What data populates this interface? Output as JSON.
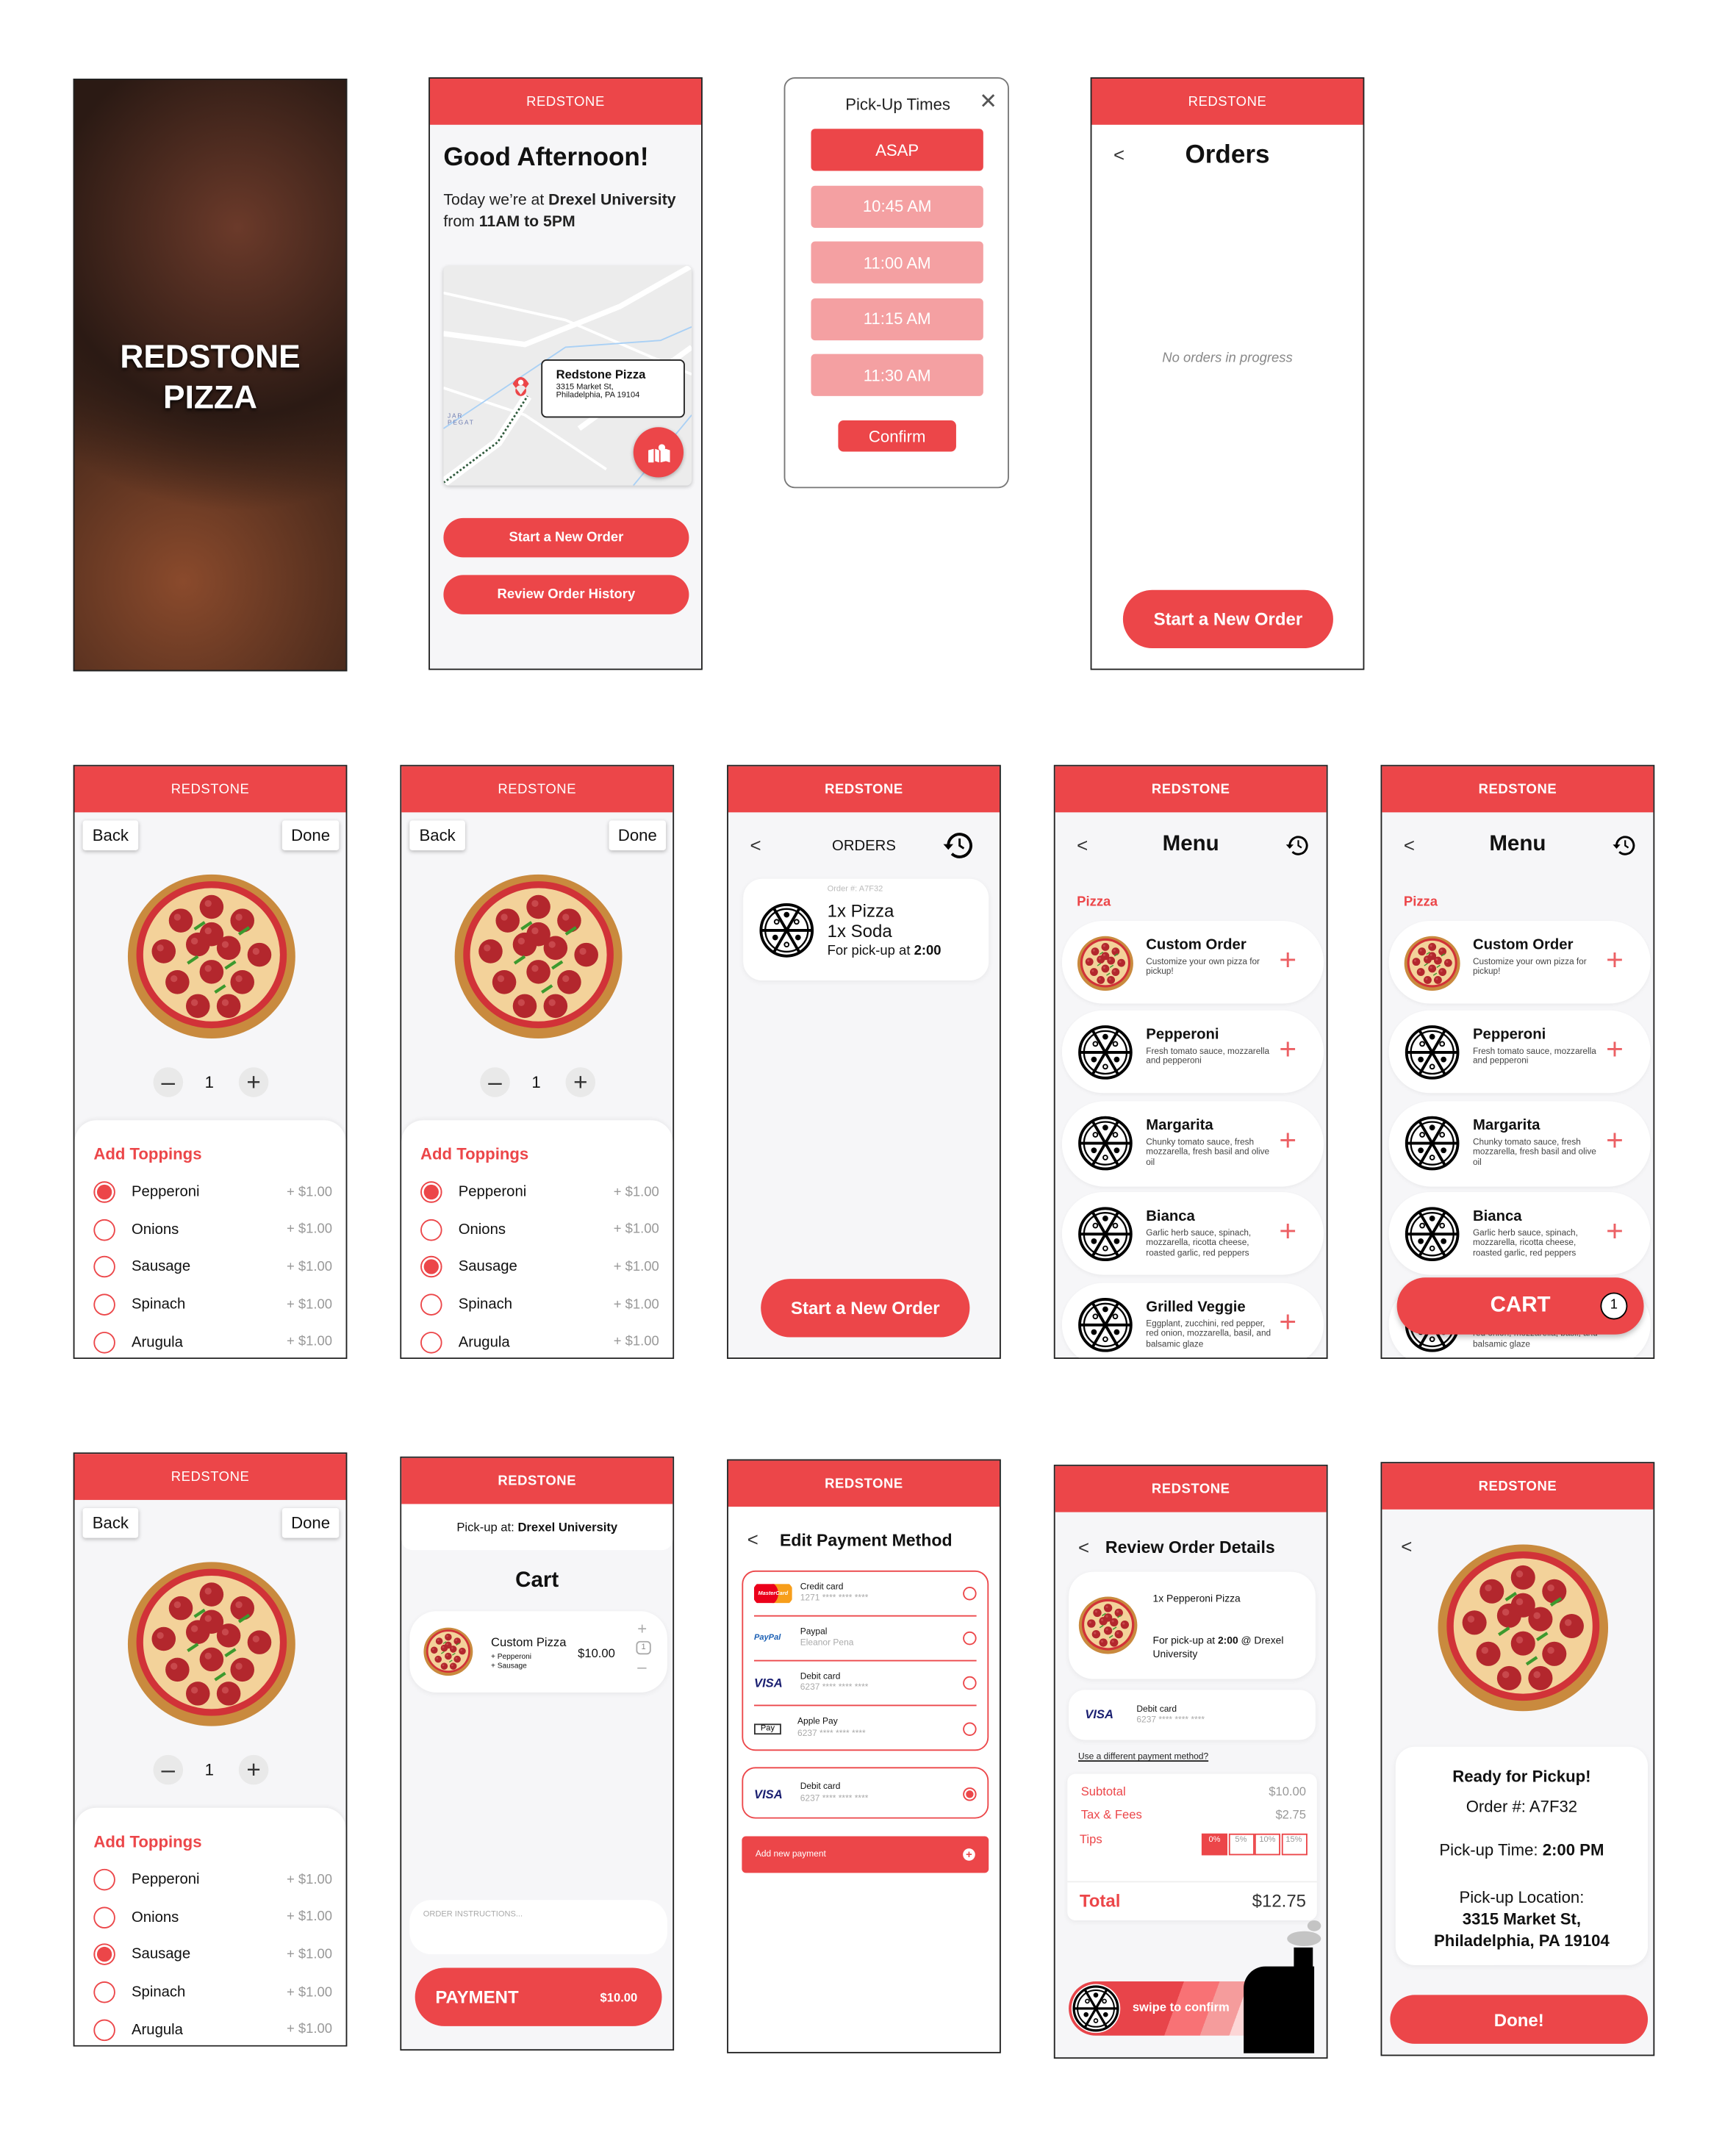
{
  "brand": "REDSTONE",
  "colors": {
    "accent": "#EC4649",
    "accent_light": "#F4A0A2",
    "background": "#F6F6F8"
  },
  "splash": {
    "title_line1": "REDSTONE",
    "title_line2": "PIZZA"
  },
  "home": {
    "greeting": "Good Afternoon!",
    "location_prefix": "Today we’re at ",
    "location": "Drexel University",
    "hours_prefix": "from ",
    "hours": "11AM to 5PM",
    "map": {
      "place_name": "Redstone Pizza",
      "address_line1": "3315 Market St,",
      "address_line2": "Philadelphia, PA 19104",
      "street_label_1": "JAR",
      "street_label_2": "PEGAT",
      "fab_icon": "map-pin-icon"
    },
    "start_order": "Start a New Order",
    "review_history": "Review Order History"
  },
  "pickup_times": {
    "title": "Pick-Up Times",
    "options": [
      "ASAP",
      "10:45 AM",
      "11:00 AM",
      "11:15 AM",
      "11:30 AM"
    ],
    "selected": "ASAP",
    "confirm": "Confirm"
  },
  "orders_empty": {
    "title": "Orders",
    "empty_text": "No orders in progress",
    "start_order": "Start a New Order"
  },
  "builder": {
    "back": "Back",
    "done": "Done",
    "quantity": "1",
    "toppings_title": "Add Toppings",
    "toppings": [
      {
        "name": "Pepperoni",
        "price": "+ $1.00"
      },
      {
        "name": "Onions",
        "price": "+ $1.00"
      },
      {
        "name": "Sausage",
        "price": "+ $1.00"
      },
      {
        "name": "Spinach",
        "price": "+ $1.00"
      },
      {
        "name": "Arugula",
        "price": "+ $1.00"
      }
    ],
    "selected_screen1": [
      "Pepperoni"
    ],
    "selected_screen2": [
      "Pepperoni",
      "Sausage"
    ],
    "selected_screen3": [
      "Sausage"
    ]
  },
  "orders": {
    "title": "ORDERS",
    "order_number": "Order #: A7F32",
    "line1": "1x Pizza",
    "line2": "1x Soda",
    "pickup_prefix": "For pick-up at ",
    "pickup_time": "2:00",
    "start_order": "Start a New Order"
  },
  "menu": {
    "title": "Menu",
    "section": "Pizza",
    "items": [
      {
        "name": "Custom Order",
        "desc": "Customize your own pizza for pickup!"
      },
      {
        "name": "Pepperoni",
        "desc": "Fresh tomato sauce, mozzarella and pepperoni"
      },
      {
        "name": "Margarita",
        "desc": "Chunky tomato sauce, fresh mozzarella, fresh basil and olive oil"
      },
      {
        "name": "Bianca",
        "desc": "Garlic herb sauce, spinach, mozzarella, ricotta cheese, roasted garlic, red peppers"
      },
      {
        "name": "Grilled Veggie",
        "desc": "Eggplant, zucchini, red pepper, red onion, mozzarella, basil, and balsamic glaze"
      }
    ],
    "cart_label": "CART",
    "cart_count": "1"
  },
  "cart": {
    "pickup_prefix": "Pick-up at: ",
    "pickup_location": "Drexel University",
    "title": "Cart",
    "item": {
      "name": "Custom Pizza",
      "toppings": [
        "+ Pepperoni",
        "+ Sausage"
      ],
      "price": "$10.00",
      "quantity": "1"
    },
    "instructions_placeholder": "ORDER INSTRUCTIONS...",
    "payment_label": "PAYMENT",
    "payment_total": "$10.00"
  },
  "payment": {
    "title": "Edit Payment Method",
    "methods": [
      {
        "logo": "MasterCard",
        "name": "Credit card",
        "detail": "1271 **** **** ****"
      },
      {
        "logo": "PayPal",
        "name": "Paypal",
        "detail": "Eleanor Pena"
      },
      {
        "logo": "VISA",
        "name": "Debit card",
        "detail": "6237 **** **** ****"
      },
      {
        "logo": "Pay",
        "name": "Apple Pay",
        "detail": "6237 **** **** ****"
      }
    ],
    "selected": {
      "logo": "VISA",
      "name": "Debit card",
      "detail": "6237 **** **** ****"
    },
    "add_new": "Add new payment"
  },
  "review": {
    "title": "Review Order Details",
    "item": "1x Pepperoni Pizza",
    "pickup_prefix": "For pick-up at ",
    "pickup_time": "2:00",
    "pickup_suffix": " @ Drexel University",
    "card_logo": "VISA",
    "card_name": "Debit card",
    "card_detail": "6237 **** **** ****",
    "different_payment": "Use a different payment method?",
    "subtotal_label": "Subtotal",
    "subtotal": "$10.00",
    "tax_label": "Tax & Fees",
    "tax": "$2.75",
    "tips_label": "Tips",
    "tips": [
      "0%",
      "5%",
      "10%",
      "15%"
    ],
    "tip_selected": "0%",
    "total_label": "Total",
    "total": "$12.75",
    "swipe": "swipe to confirm"
  },
  "ready": {
    "title": "Ready for Pickup!",
    "order": "Order #: A7F32",
    "time_prefix": "Pick-up Time: ",
    "time": "2:00 PM",
    "location_label": "Pick-up Location:",
    "address1": "3315 Market St,",
    "address2": "Philadelphia, PA 19104",
    "done": "Done!"
  }
}
